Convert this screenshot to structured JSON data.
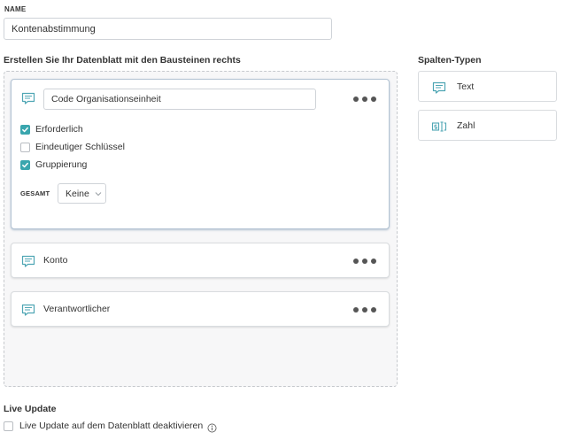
{
  "name_section": {
    "label": "NAME",
    "value": "Kontenabstimmung"
  },
  "builder": {
    "title": "Erstellen Sie Ihr Datenblatt mit den Bausteinen rechts",
    "expanded_field": {
      "name": "Code Organisationseinheit",
      "icon": "text-field-icon",
      "options": [
        {
          "label": "Erforderlich",
          "checked": true
        },
        {
          "label": "Eindeutiger Schlüssel",
          "checked": false
        },
        {
          "label": "Gruppierung",
          "checked": true
        }
      ],
      "total_label": "GESAMT",
      "total_value": "Keine"
    },
    "fields": [
      {
        "name": "Konto",
        "icon": "text-field-icon"
      },
      {
        "name": "Verantwortlicher",
        "icon": "text-field-icon"
      }
    ]
  },
  "column_types": {
    "title": "Spalten-Typen",
    "items": [
      {
        "label": "Text",
        "icon": "text-type-icon"
      },
      {
        "label": "Zahl",
        "icon": "number-type-icon"
      }
    ]
  },
  "live_update": {
    "title": "Live Update",
    "checkbox_label": "Live Update auf dem Datenblatt deaktivieren",
    "checked": false
  },
  "colors": {
    "accent": "#3aa6ae",
    "icon_teal": "#4fa6b4"
  }
}
